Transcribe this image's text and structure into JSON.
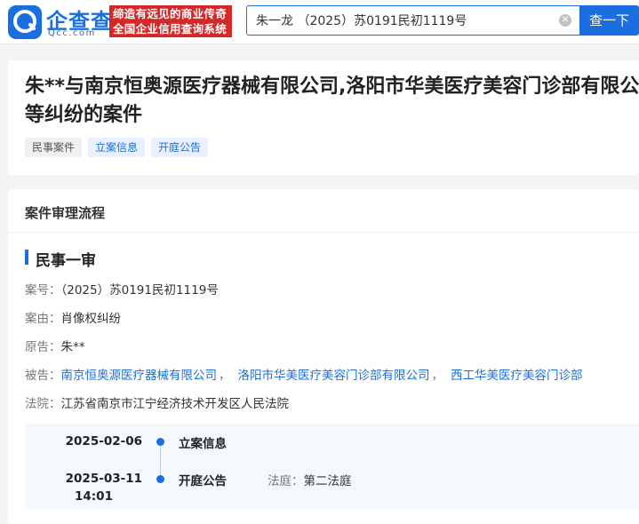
{
  "header": {
    "logo_name": "企查查",
    "logo_sub": "Qcc.com",
    "slogan_line1": "缔造有远见的商业传奇",
    "slogan_line2": "全国企业信用查询系统",
    "search_value": "朱一龙 （2025）苏0191民初1119号",
    "search_button": "查一下",
    "brand_color": "#1a6fe0"
  },
  "case": {
    "title": "朱**与南京恒奥源医疗器械有限公司,洛阳市华美医疗美容门诊部有限公司等纠纷的案件",
    "tags": [
      "民事案件",
      "立案信息",
      "开庭公告"
    ]
  },
  "process": {
    "section_title": "案件审理流程",
    "stage_title": "民事一审",
    "case_no_label": "案号：",
    "case_no": "（2025）苏0191民初1119号",
    "cause_label": "案由：",
    "cause": "肖像权纠纷",
    "plaintiff_label": "原告：",
    "plaintiff": "朱**",
    "defendant_label": "被告：",
    "defendants": [
      "南京恒奥源医疗器械有限公司",
      "洛阳市华美医疗美容门诊部有限公司",
      "西工华美医疗美容门诊部"
    ],
    "separator": "，",
    "court_label": "法院：",
    "court": "江苏省南京市江宁经济技术开发区人民法院",
    "timeline": [
      {
        "date": "2025-02-06",
        "time": "",
        "event": "立案信息",
        "extra_label": "",
        "extra_value": ""
      },
      {
        "date": "2025-03-11",
        "time": "14:01",
        "event": "开庭公告",
        "extra_label": "法庭：",
        "extra_value": "第二法庭"
      }
    ]
  }
}
